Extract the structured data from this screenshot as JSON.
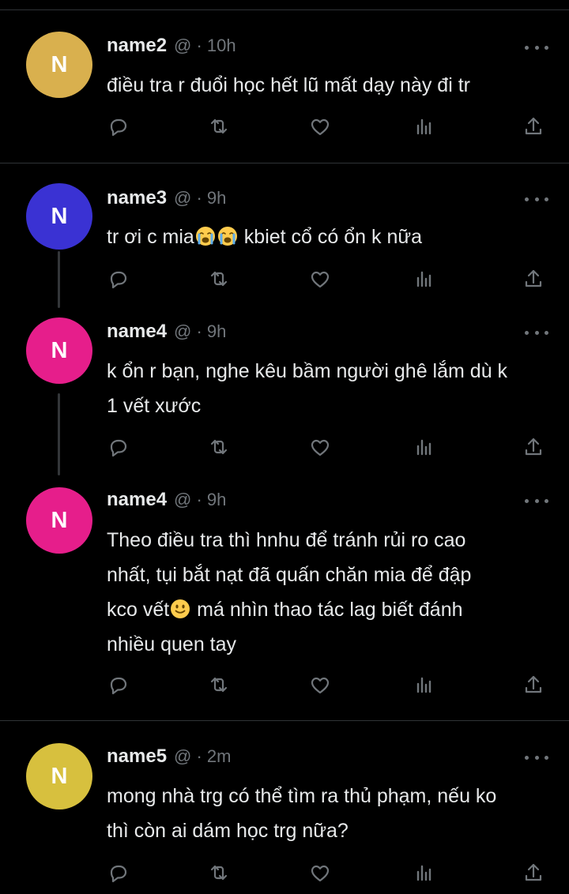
{
  "theme": {
    "background": "#000000",
    "text": "#e7e9ea",
    "muted": "#71767b",
    "divider": "#2f3336"
  },
  "tweets": [
    {
      "name": "name2",
      "meta": "@ · 10h",
      "avatar_letter": "N",
      "avatar_color": "#d9b04e",
      "text": [
        "điều tra r đuổi học hết lũ mất dạy này đi tr"
      ]
    },
    {
      "name": "name3",
      "meta": "@ · 9h",
      "avatar_letter": "N",
      "avatar_color": "#3a32d3",
      "text_a": "tr ơi c mia",
      "emoji_a": "loudly-crying-face",
      "emoji_b": "loudly-crying-face",
      "text_b": " kbiet cổ có ổn k nữa"
    },
    {
      "name": "name4",
      "meta": "@ · 9h",
      "avatar_letter": "N",
      "avatar_color": "#e61e8b",
      "text": [
        "k ổn r bạn, nghe kêu bầm người ghê lắm dù k",
        "1 vết xước"
      ]
    },
    {
      "name": "name4",
      "meta": "@ · 9h",
      "avatar_letter": "N",
      "avatar_color": "#e61e8b",
      "text": [
        "Theo điều tra thì hnhu để tránh rủi ro cao",
        "nhất, tụi bắt nạt đã quấn chăn mia để đập"
      ],
      "line3_a": "kco vết",
      "emoji": "slightly-smiling-face",
      "line3_b": " má nhìn thao tác lag biết đánh",
      "line4": "nhiều quen tay"
    },
    {
      "name": "name5",
      "meta": "@ · 2m",
      "avatar_letter": "N",
      "avatar_color": "#d7c03e",
      "text": [
        "mong nhà trg có thể tìm ra thủ phạm, nếu ko",
        "thì còn ai dám học trg nữa?"
      ]
    }
  ],
  "action_icons": [
    "reply-icon",
    "retweet-icon",
    "like-icon",
    "views-icon",
    "share-icon"
  ]
}
